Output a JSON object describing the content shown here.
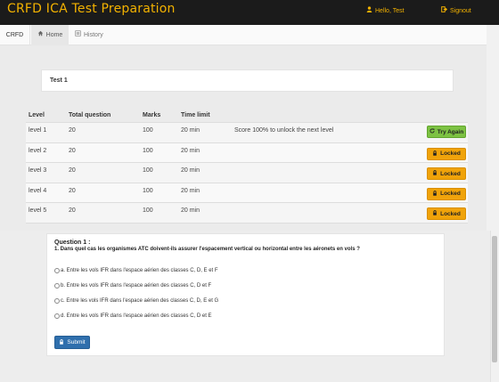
{
  "app": {
    "brand": "CRFD ICA Test Preparation",
    "greeting": "Hello, Test",
    "signout_label": "Signout",
    "user_icon": "user-icon",
    "signout_icon": "signout-icon",
    "brand_color": "#f3b200"
  },
  "nav": {
    "brand": "CRFD",
    "home_label": "Home",
    "history_label": "History",
    "home_icon": "home-icon",
    "history_icon": "list-icon"
  },
  "test": {
    "title": "Test 1"
  },
  "levels": {
    "headers": {
      "level": "Level",
      "total": "Total question",
      "marks": "Marks",
      "time": "Time limit"
    },
    "rows": [
      {
        "level": "level 1",
        "total": "20",
        "marks": "100",
        "time": "20 min",
        "note": "Score 100% to unlock the next level",
        "action": "Try Again",
        "state": "try"
      },
      {
        "level": "level 2",
        "total": "20",
        "marks": "100",
        "time": "20 min",
        "note": "",
        "action": "Locked",
        "state": "locked"
      },
      {
        "level": "level 3",
        "total": "20",
        "marks": "100",
        "time": "20 min",
        "note": "",
        "action": "Locked",
        "state": "locked"
      },
      {
        "level": "level 4",
        "total": "20",
        "marks": "100",
        "time": "20 min",
        "note": "",
        "action": "Locked",
        "state": "locked"
      },
      {
        "level": "level 5",
        "total": "20",
        "marks": "100",
        "time": "20 min",
        "note": "",
        "action": "Locked",
        "state": "locked"
      }
    ]
  },
  "question": {
    "number_label": "Question  1 :",
    "text": "1. Dans quel cas les organismes ATC doivent-ils assurer l'espacement vertical ou horizontal entre les aéronets en vols ?",
    "options": [
      "a. Entre les vols IFR dans l'espace aérien des classes C, D, E et F",
      "b. Entre les vols IFR dans l'espace aérien des classes C, D et F",
      "c. Entre les vols IFR dans l'espace aérien des classes C, D, E et G",
      "d. Entre les vols IFR dans l'espace aérien des classes C, D et E"
    ],
    "submit_label": "Submit",
    "submit_icon": "lock-icon"
  }
}
